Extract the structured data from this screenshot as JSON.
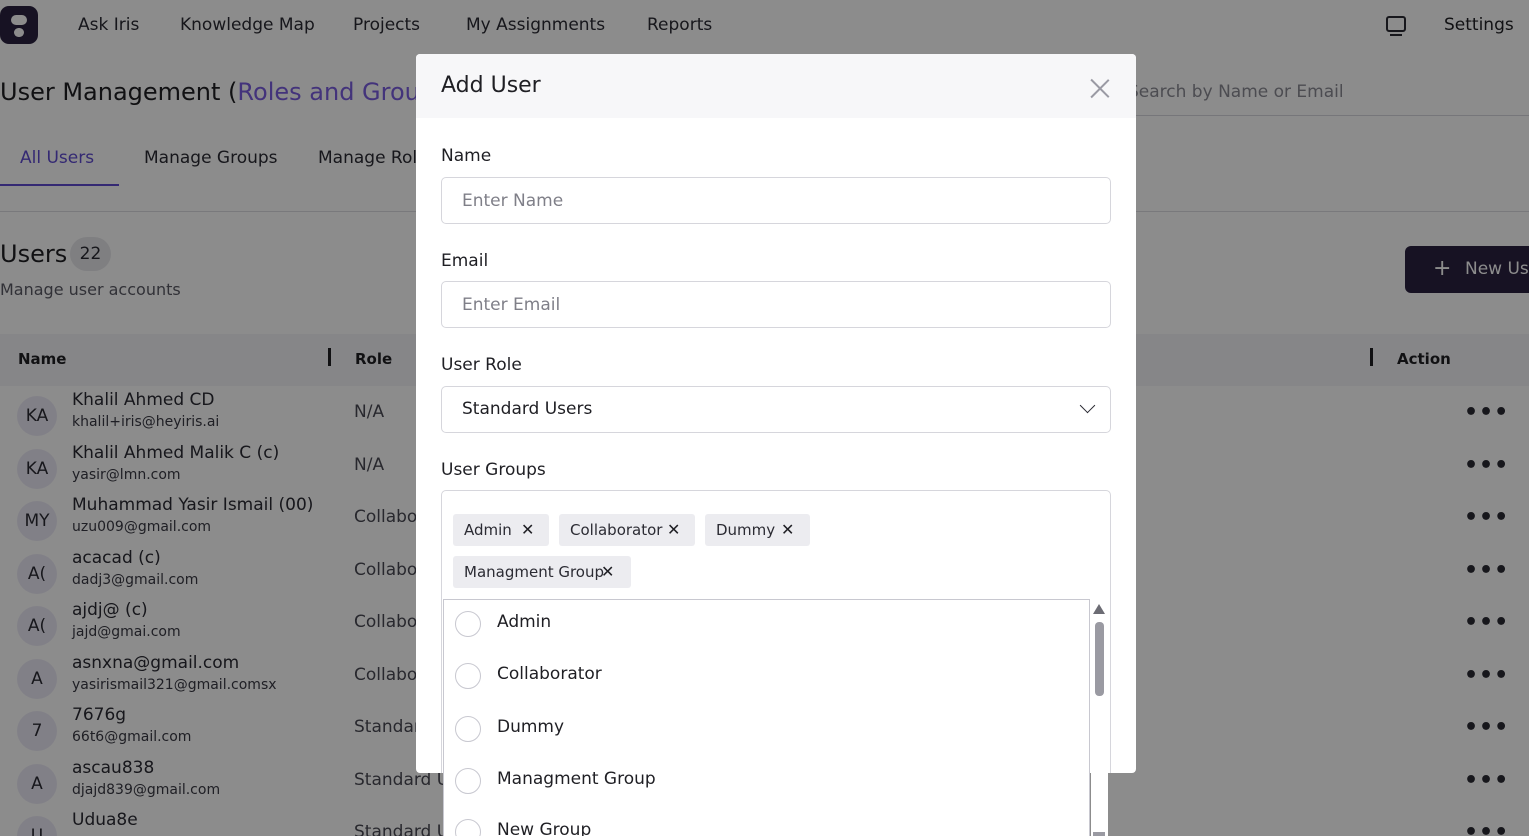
{
  "nav": {
    "items": [
      "Ask Iris",
      "Knowledge Map",
      "Projects",
      "My Assignments",
      "Reports"
    ],
    "settings": "Settings"
  },
  "page": {
    "title_prefix": "User Management (",
    "title_accent": "Roles and Groups)",
    "search_placeholder": "Search by Name or Email"
  },
  "tabs": [
    "All Users",
    "Manage Groups",
    "Manage Roles"
  ],
  "users_section": {
    "title": "Users",
    "count": "22",
    "subtitle": "Manage user accounts",
    "new_button": "New User"
  },
  "table": {
    "headers": {
      "name": "Name",
      "role": "Role",
      "action": "Action"
    },
    "rows": [
      {
        "initials": "KA",
        "name": "Khalil Ahmed CD",
        "email": "khalil+iris@heyiris.ai",
        "role": "N/A"
      },
      {
        "initials": "KA",
        "name": "Khalil Ahmed Malik C (c)",
        "email": "yasir@lmn.com",
        "role": "N/A"
      },
      {
        "initials": "MY",
        "name": "Muhammad Yasir Ismail (00)",
        "email": "uzu009@gmail.com",
        "role": "Collaborator"
      },
      {
        "initials": "A(",
        "name": "acacad (c)",
        "email": "dadj3@gmail.com",
        "role": "Collaborator"
      },
      {
        "initials": "A(",
        "name": "ajdj@ (c)",
        "email": "jajd@gmai.com",
        "role": "Collaborator"
      },
      {
        "initials": "A",
        "name": "asnxna@gmail.com",
        "email": "yasirismail321@gmail.comsx",
        "role": "Collaborator"
      },
      {
        "initials": "7",
        "name": "7676g",
        "email": "66t6@gmail.com",
        "role": "Standard Users"
      },
      {
        "initials": "A",
        "name": "ascau838",
        "email": "djajd839@gmail.com",
        "role": "Standard Users"
      },
      {
        "initials": "U",
        "name": "Udua8e",
        "email": "",
        "role": "Standard Users"
      }
    ]
  },
  "modal": {
    "title": "Add User",
    "name_label": "Name",
    "name_placeholder": "Enter Name",
    "email_label": "Email",
    "email_placeholder": "Enter Email",
    "role_label": "User Role",
    "role_value": "Standard Users",
    "groups_label": "User Groups",
    "selected_groups": [
      "Admin",
      "Collaborator",
      "Dummy",
      "Managment Group"
    ]
  },
  "dropdown": {
    "options": [
      "Admin",
      "Collaborator",
      "Dummy",
      "Managment Group",
      "New Group"
    ]
  }
}
